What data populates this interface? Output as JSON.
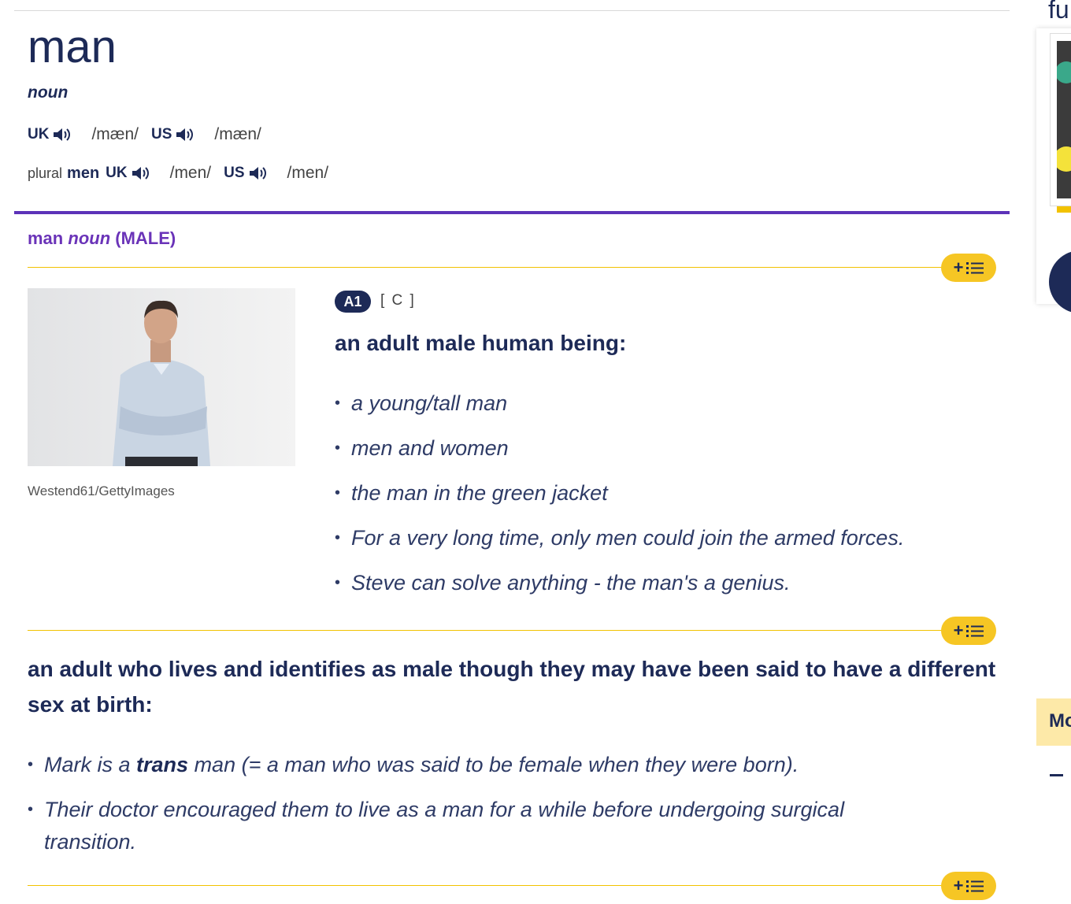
{
  "entry": {
    "headword": "man",
    "pos": "noun",
    "pronunciations": {
      "uk_label": "UK",
      "uk_ipa": "/mæn/",
      "us_label": "US",
      "us_ipa": "/mæn/"
    },
    "plural": {
      "label": "plural",
      "form": "men",
      "uk_label": "UK",
      "uk_ipa": "/men/",
      "us_label": "US",
      "us_ipa": "/men/"
    },
    "icons": {
      "speaker": "speaker-icon",
      "wordlist": "add-to-wordlist-icon"
    }
  },
  "sense": {
    "word": "man",
    "pos": "noun",
    "guide": "(MALE)",
    "add_plus": "+"
  },
  "block1": {
    "image_credit": "Westend61/GettyImages",
    "level": "A1",
    "grammar": "[ C ]",
    "definition": "an adult male human being:",
    "examples": [
      "a young/tall man",
      "men and women",
      "the man in the green jacket",
      "For a very long time, only men could join the armed forces.",
      "Steve can solve anything - the man's a genius."
    ]
  },
  "block2": {
    "definition": "an adult who lives and identifies as male though they may have been said to have a different sex at birth:",
    "example1_pre": "Mark is a ",
    "example1_bold": "trans",
    "example1_post": " man (= a man who was said to be female when they were born).",
    "example2": "Their doctor encouraged them to live as a man for a while before undergoing surgical transition."
  },
  "sidebar": {
    "heading_fragment": "fu",
    "more_fragment": "Mo",
    "colors": {
      "accent": "#f6c624",
      "purple": "#5c32b8",
      "navy": "#1d2a57"
    }
  }
}
